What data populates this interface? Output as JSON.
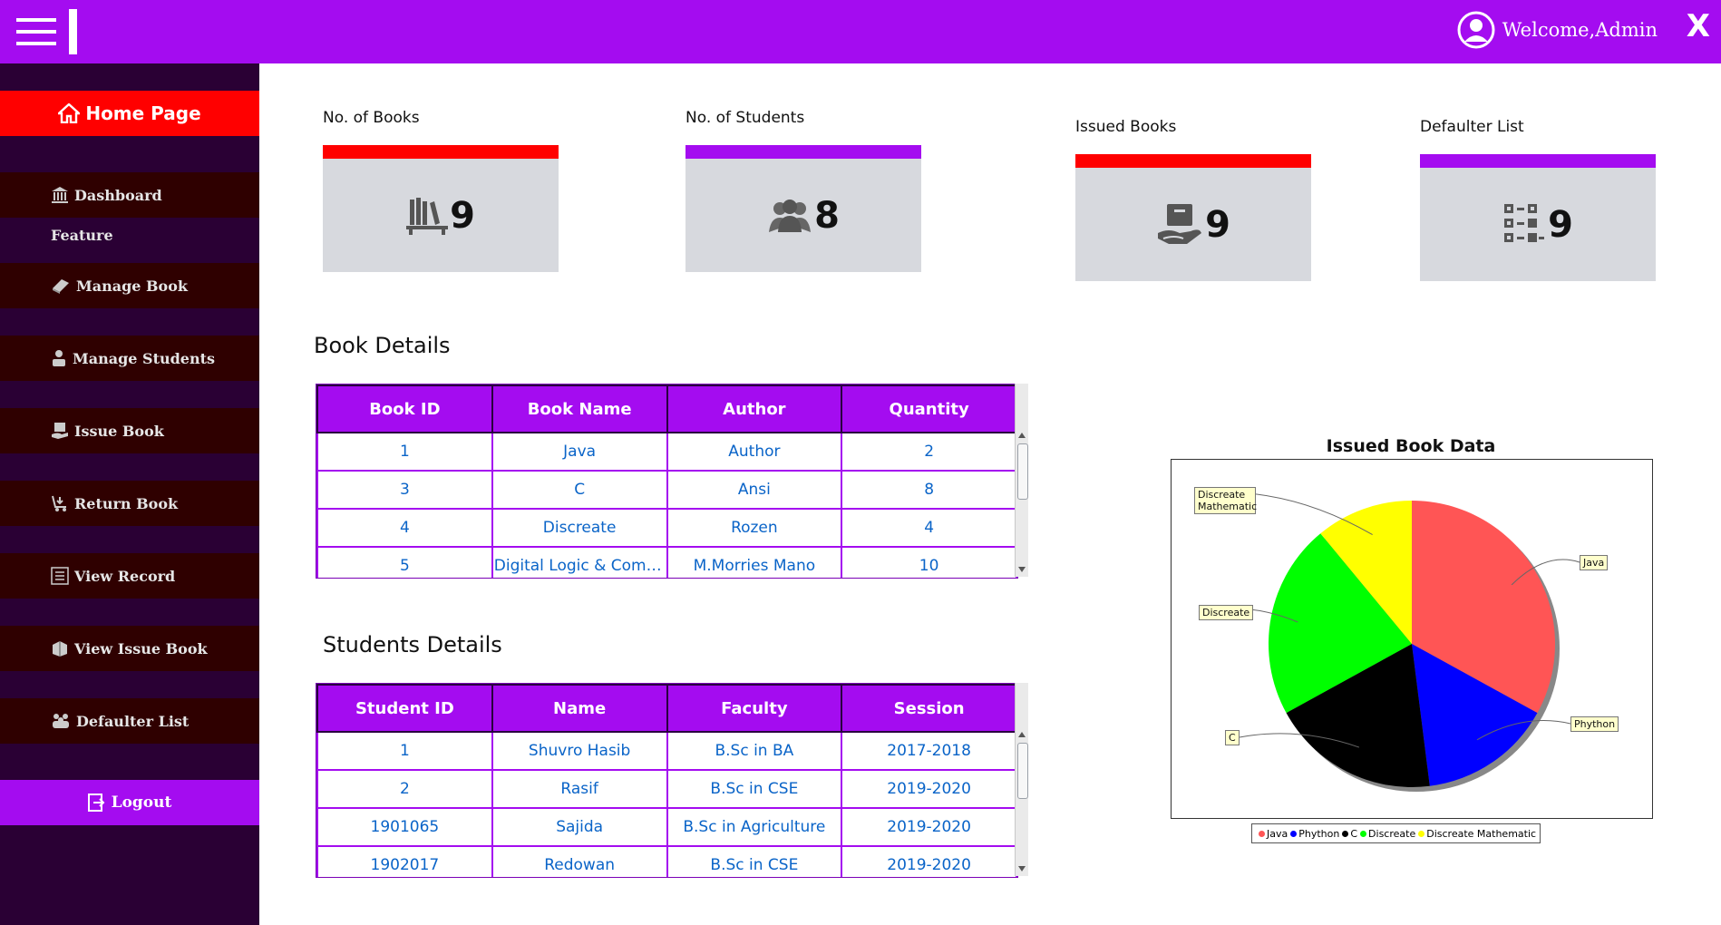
{
  "header": {
    "welcome_text": "Welcome,Admin",
    "close_label": "X",
    "accent_color": "#a40cf0"
  },
  "sidebar": {
    "home_label": "Home Page",
    "dashboard_label": "Dashboard",
    "feature_label": "Feature",
    "items": [
      {
        "label": "Manage Book",
        "icon": "book-icon"
      },
      {
        "label": "Manage Students",
        "icon": "student-icon"
      },
      {
        "label": "Issue Book",
        "icon": "issue-book-icon"
      },
      {
        "label": "Return Book",
        "icon": "return-book-icon"
      },
      {
        "label": "View Record",
        "icon": "list-icon"
      },
      {
        "label": "View Issue Book",
        "icon": "books-stack-icon"
      },
      {
        "label": "Defaulter List",
        "icon": "people-icon"
      }
    ],
    "logout_label": "Logout"
  },
  "cards": [
    {
      "label": "No. of Books",
      "value": "9",
      "bar_color": "#ff0000",
      "icon": "bookshelf-icon"
    },
    {
      "label": "No. of Students",
      "value": "8",
      "bar_color": "#a40cf0",
      "icon": "group-icon"
    },
    {
      "label": "Issued Books",
      "value": "9",
      "bar_color": "#ff0000",
      "icon": "hand-book-icon"
    },
    {
      "label": "Defaulter List",
      "value": "9",
      "bar_color": "#a40cf0",
      "icon": "checklist-icon"
    }
  ],
  "book_details": {
    "title": "Book Details",
    "columns": [
      "Book ID",
      "Book Name",
      "Author",
      "Quantity"
    ],
    "rows": [
      [
        "1",
        "Java",
        "Author",
        "2"
      ],
      [
        "3",
        "C",
        "Ansi",
        "8"
      ],
      [
        "4",
        "Discreate",
        "Rozen",
        "4"
      ],
      [
        "5",
        "Digital Logic & Comp...",
        "M.Morries Mano",
        "10"
      ]
    ]
  },
  "student_details": {
    "title": "Students Details",
    "columns": [
      "Student ID",
      "Name",
      "Faculty",
      "Session"
    ],
    "rows": [
      [
        "1",
        "Shuvro Hasib",
        "B.Sc in BA",
        "2017-2018"
      ],
      [
        "2",
        "Rasif",
        "B.Sc in CSE",
        "2019-2020"
      ],
      [
        "1901065",
        "Sajida",
        "B.Sc in Agriculture",
        "2019-2020"
      ],
      [
        "1902017",
        "Redowan",
        "B.Sc in CSE",
        "2019-2020"
      ]
    ]
  },
  "chart_data": {
    "type": "pie",
    "title": "Issued Book Data",
    "categories": [
      "Java",
      "Phython",
      "C",
      "Discreate",
      "Discreate Mathematic"
    ],
    "values": [
      33,
      15,
      19,
      22,
      11
    ],
    "colors": [
      "#ff5555",
      "#0000ff",
      "#000000",
      "#00ff00",
      "#ffff00",
      "#00ffff"
    ],
    "slice_labels": [
      "Java",
      "Phython",
      "C",
      "Discreate",
      "Discreate Mathematic"
    ],
    "legend": [
      "Java",
      "Phython",
      "C",
      "Discreate",
      "Discreate Mathematic"
    ],
    "legend_placement": "bottom"
  }
}
